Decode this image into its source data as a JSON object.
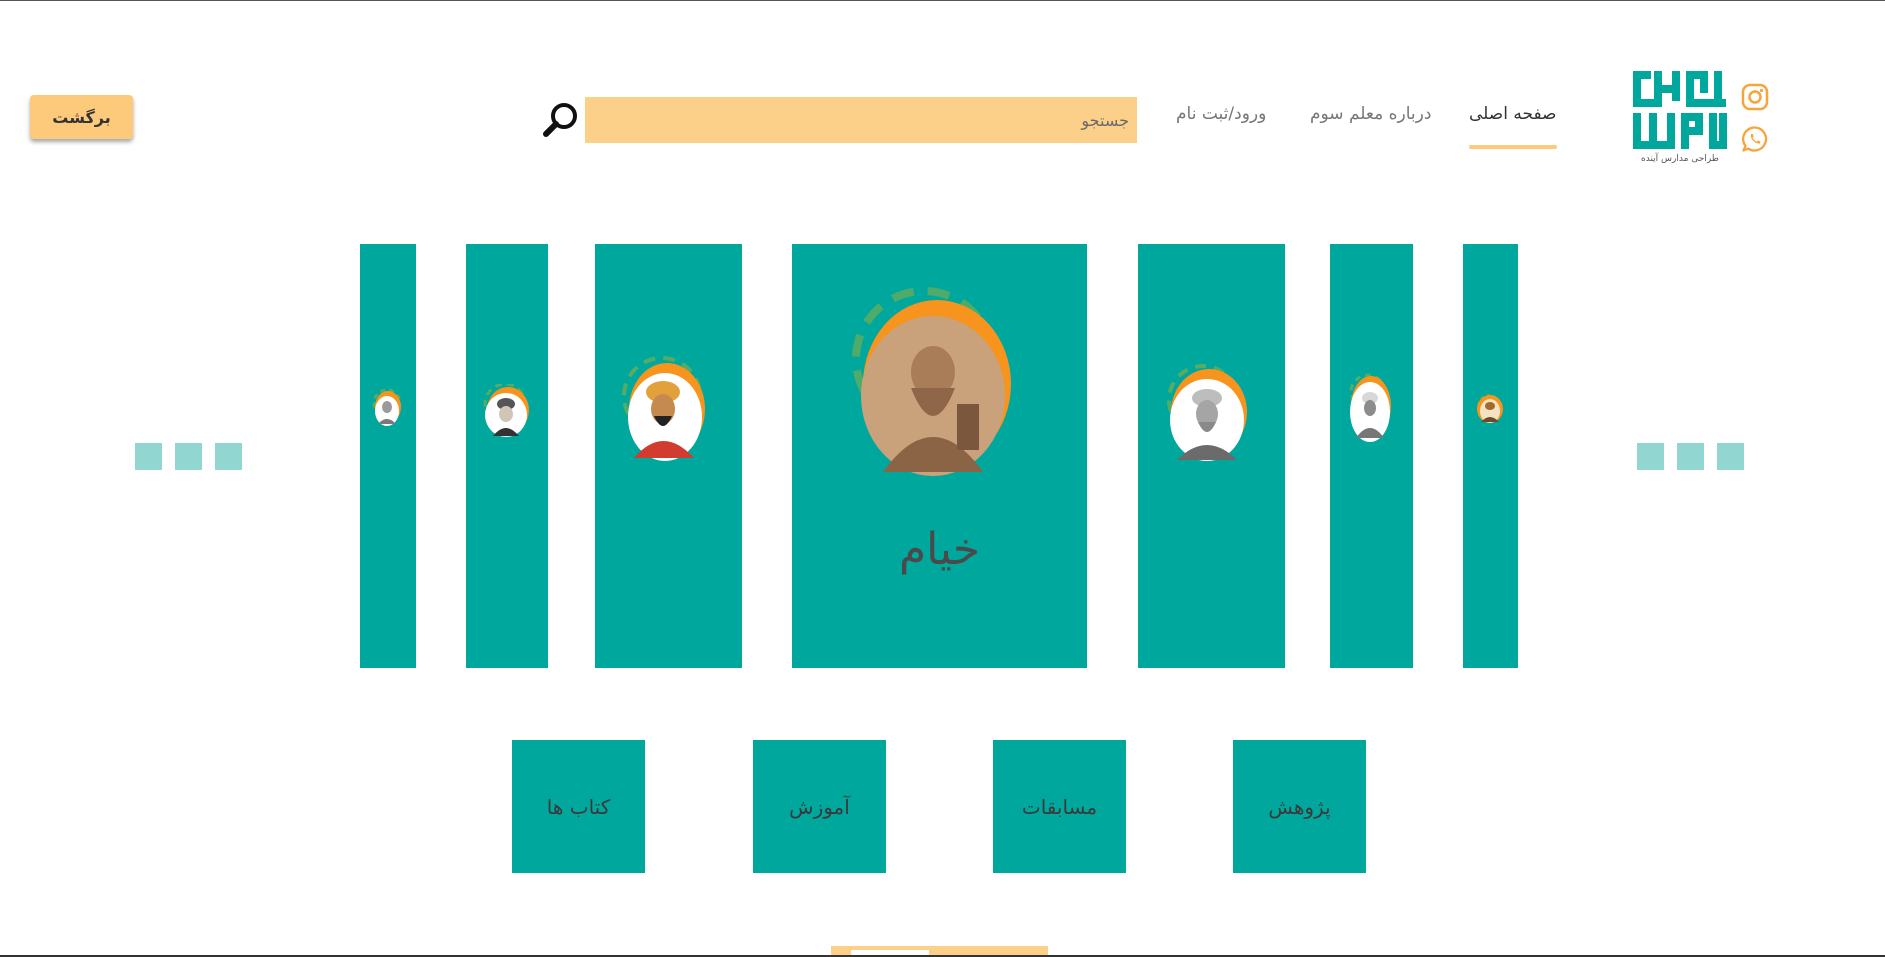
{
  "header": {
    "back_label": "برگشت",
    "search_placeholder": "جستجو",
    "nav": {
      "home": "صفحه اصلی",
      "about": "درباره معلم سوم",
      "login": "ورود/ثبت نام"
    },
    "logo": {
      "wordmark": "معلم سوم",
      "tagline": "طراحی مدارس آینده"
    },
    "social_icons": [
      "instagram-icon",
      "whatsapp-icon"
    ]
  },
  "carousel": {
    "active_title": "خیام",
    "cards": [
      {
        "name": "scholar-1"
      },
      {
        "name": "scholar-2"
      },
      {
        "name": "scholar-3"
      },
      {
        "name": "khayyam"
      },
      {
        "name": "scholar-5"
      },
      {
        "name": "scholar-6"
      },
      {
        "name": "scholar-7"
      }
    ]
  },
  "categories": [
    {
      "label": "کتاب ها"
    },
    {
      "label": "آموزش"
    },
    {
      "label": "مسابقات"
    },
    {
      "label": "پژوهش"
    }
  ],
  "colors": {
    "teal": "#00a79d",
    "light_teal": "#92d6d2",
    "orange": "#f7941d",
    "peach": "#fdc97a"
  }
}
